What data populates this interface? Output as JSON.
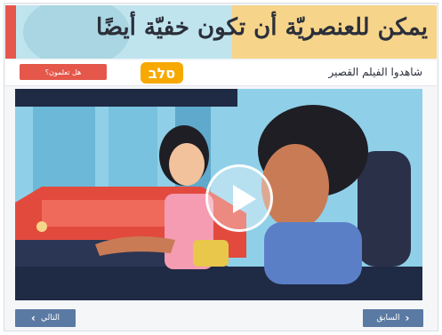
{
  "header": {
    "title": "يمكن للعنصريّة أن تكون خفيّة أيضًا"
  },
  "subheader": {
    "quiz_button": "هل تعلمون؟",
    "logo_text": "סלב",
    "watch_label": "شاهدوا الفيلم القصير"
  },
  "video": {
    "play_icon": "play-icon"
  },
  "footer": {
    "next_label": "التالي",
    "prev_label": "السابق"
  }
}
